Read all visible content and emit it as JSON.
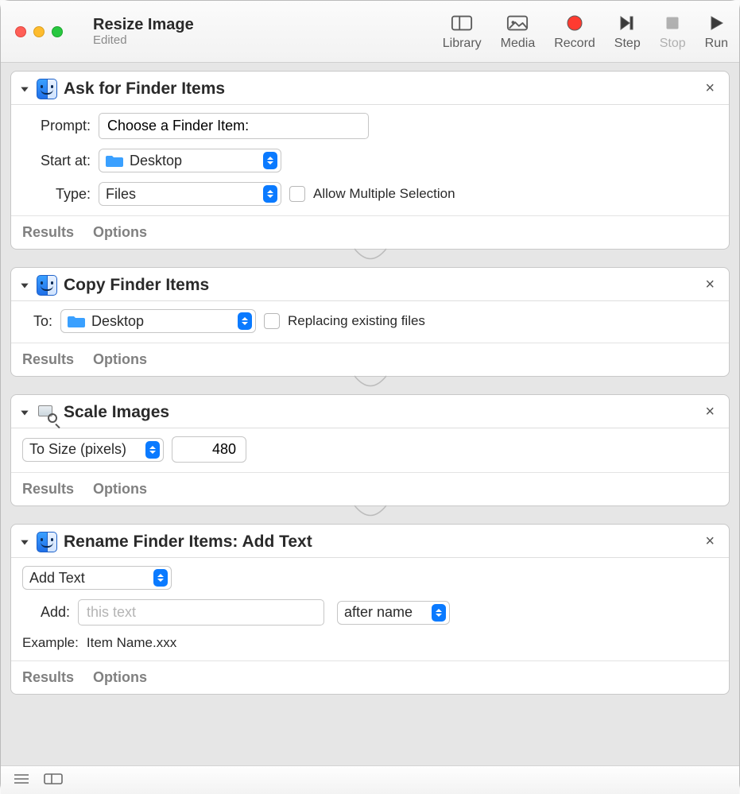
{
  "window": {
    "title": "Resize Image",
    "subtitle": "Edited"
  },
  "toolbar": {
    "library": "Library",
    "media": "Media",
    "record": "Record",
    "step": "Step",
    "stop": "Stop",
    "run": "Run"
  },
  "actions": [
    {
      "title": "Ask for Finder Items",
      "icon": "finder",
      "fields": {
        "prompt_label": "Prompt:",
        "prompt_value": "Choose a Finder Item:",
        "start_label": "Start at:",
        "start_value": "Desktop",
        "type_label": "Type:",
        "type_value": "Files",
        "allow_multiple_label": "Allow Multiple Selection",
        "allow_multiple_checked": false
      }
    },
    {
      "title": "Copy Finder Items",
      "icon": "finder",
      "fields": {
        "to_label": "To:",
        "to_value": "Desktop",
        "replace_label": "Replacing existing files",
        "replace_checked": false
      }
    },
    {
      "title": "Scale Images",
      "icon": "preview",
      "fields": {
        "mode_value": "To Size (pixels)",
        "size_value": "480"
      }
    },
    {
      "title": "Rename Finder Items: Add Text",
      "icon": "finder",
      "fields": {
        "mode_value": "Add Text",
        "add_label": "Add:",
        "add_placeholder": "this text",
        "add_value": "",
        "position_value": "after name",
        "example_label": "Example:",
        "example_value": "Item Name.xxx"
      }
    }
  ],
  "footer": {
    "results": "Results",
    "options": "Options"
  }
}
